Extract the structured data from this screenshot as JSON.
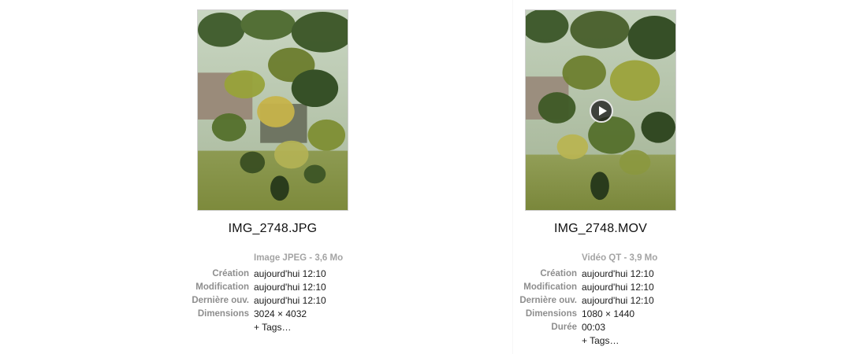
{
  "left_item": {
    "filename": "IMG_2748.JPG",
    "kind": "Image JPEG - 3,6 Mo",
    "thumbnail_icon": "photo-thumbnail",
    "rows": [
      {
        "label": "Création",
        "value": "aujourd'hui 12:10"
      },
      {
        "label": "Modification",
        "value": "aujourd'hui 12:10"
      },
      {
        "label": "Dernière ouv.",
        "value": "aujourd'hui 12:10"
      },
      {
        "label": "Dimensions",
        "value": "3024 × 4032"
      }
    ],
    "tags_link": "+ Tags…"
  },
  "right_item": {
    "filename": "IMG_2748.MOV",
    "kind": "Vidéo QT - 3,9 Mo",
    "thumbnail_icon": "video-thumbnail",
    "play_icon": "play-icon",
    "rows": [
      {
        "label": "Création",
        "value": "aujourd'hui 12:10"
      },
      {
        "label": "Modification",
        "value": "aujourd'hui 12:10"
      },
      {
        "label": "Dernière ouv.",
        "value": "aujourd'hui 12:10"
      },
      {
        "label": "Dimensions",
        "value": "1080 × 1440"
      },
      {
        "label": "Durée",
        "value": "00:03"
      }
    ],
    "tags_link": "+ Tags…"
  },
  "colors": {
    "label": "#8e8e8e",
    "value": "#1a1a1a",
    "link": "#3b7fdb",
    "kind": "#a4a4a4"
  }
}
